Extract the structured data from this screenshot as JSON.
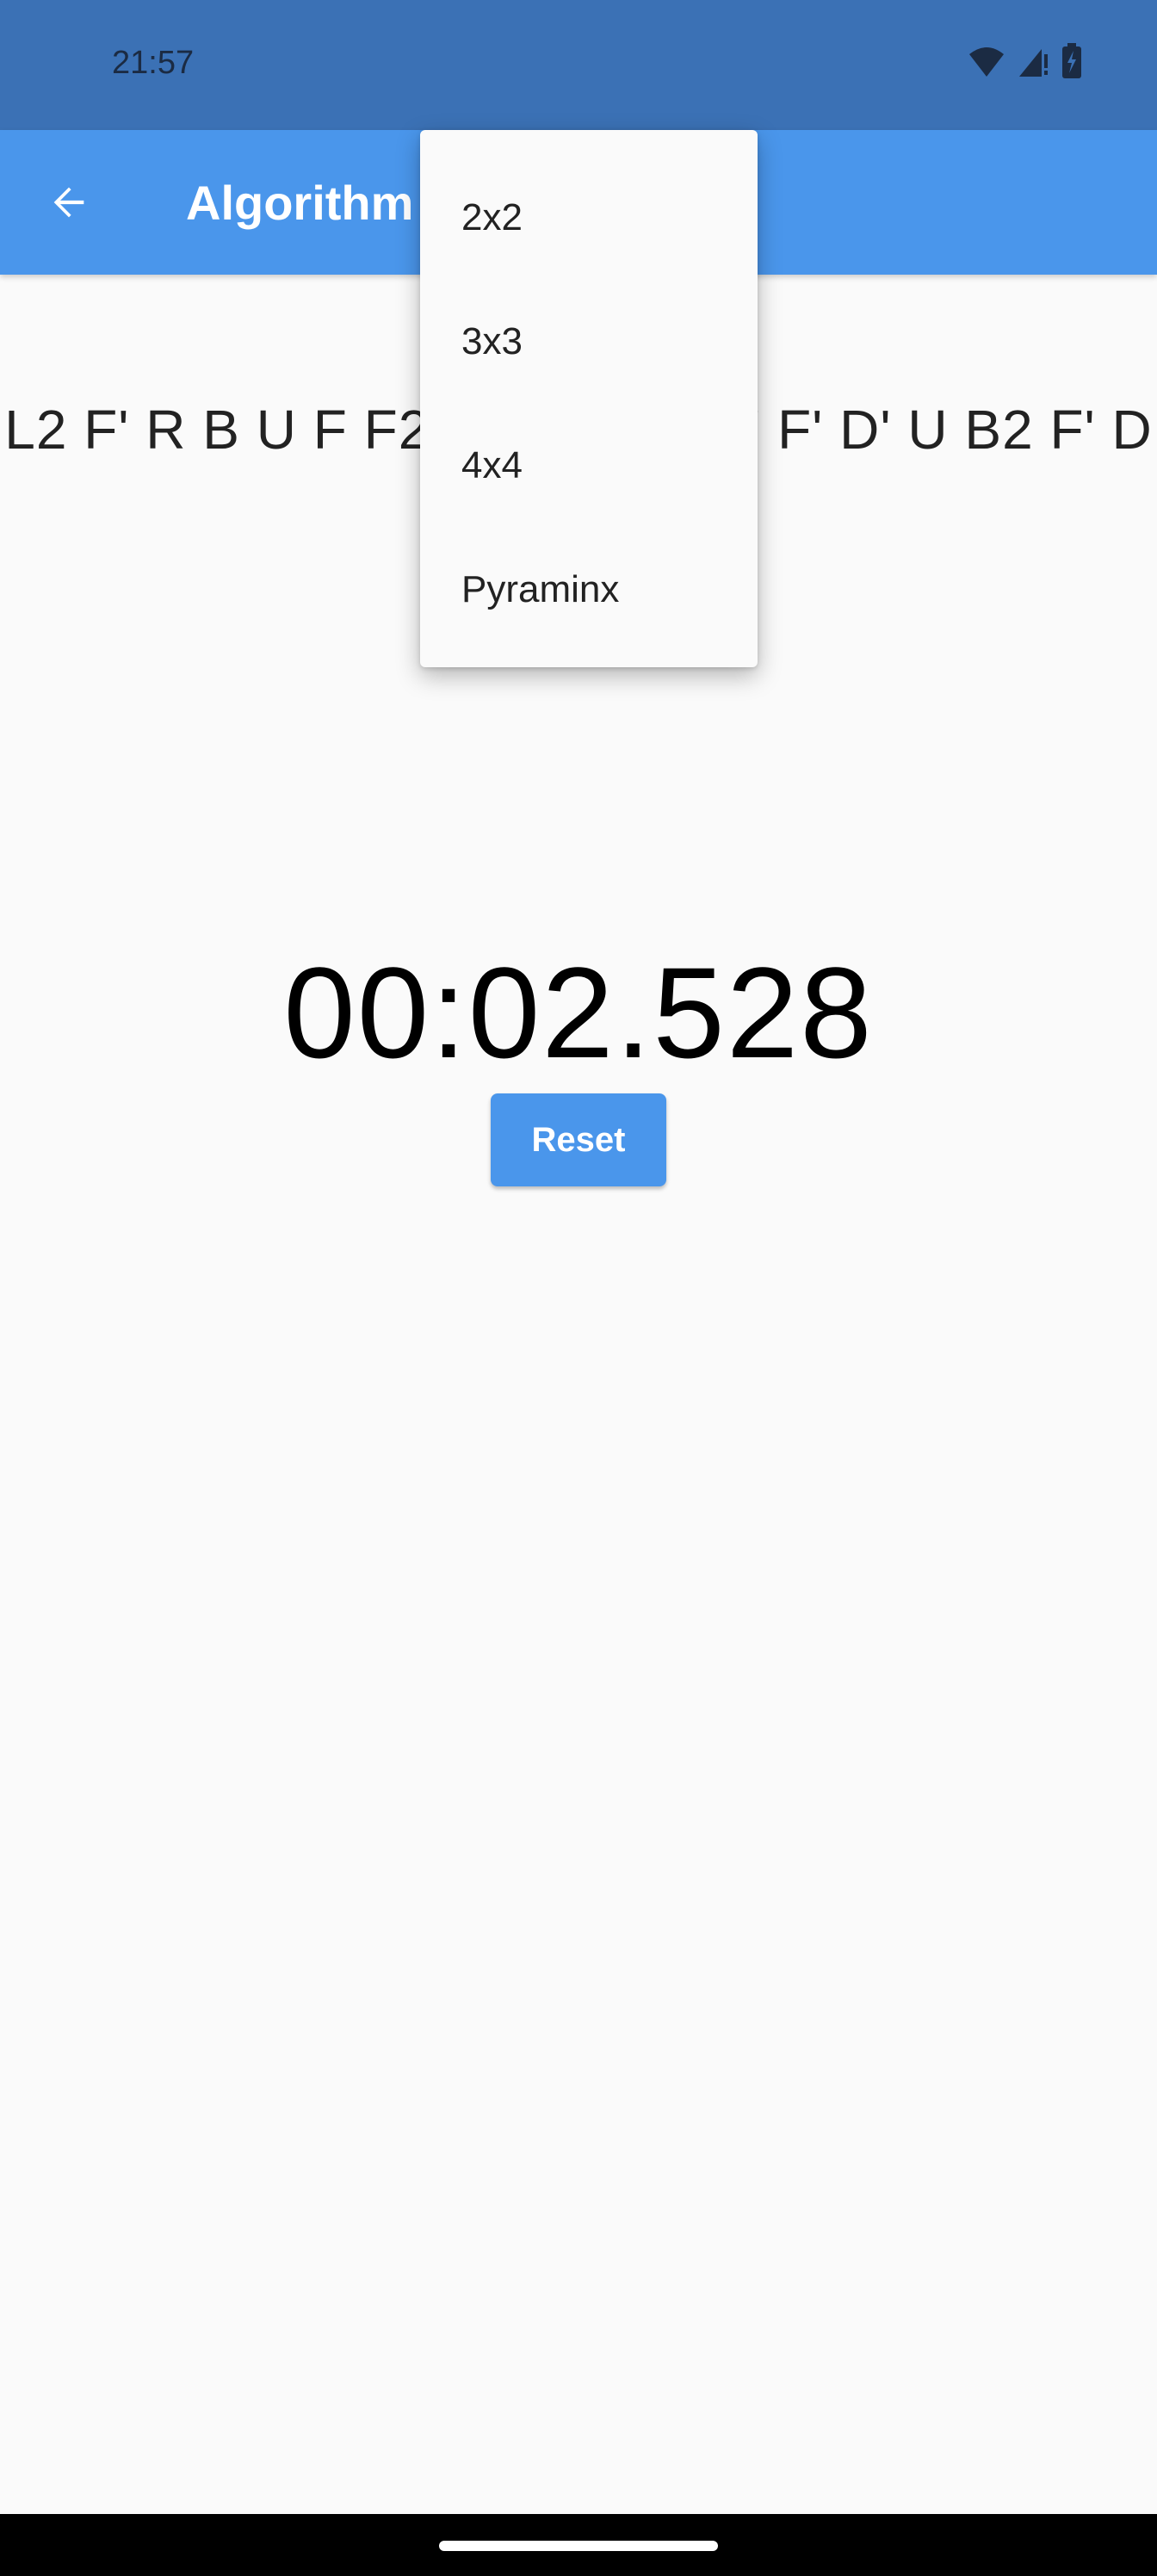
{
  "status_bar": {
    "time": "21:57"
  },
  "app_bar": {
    "title": "Algorithm"
  },
  "scramble": {
    "text": "L2 F' R B U F F2 D F2 R' L' B' F' D' U B2 F' D"
  },
  "timer": {
    "value": "00:02.528"
  },
  "controls": {
    "reset_label": "Reset"
  },
  "dropdown": {
    "items": [
      {
        "label": "2x2"
      },
      {
        "label": "3x3"
      },
      {
        "label": "4x4"
      },
      {
        "label": "Pyraminx"
      }
    ]
  },
  "colors": {
    "status_bar": "#3b71b5",
    "app_bar": "#4a96eb",
    "accent": "#4a96eb",
    "background": "#fafafa"
  }
}
